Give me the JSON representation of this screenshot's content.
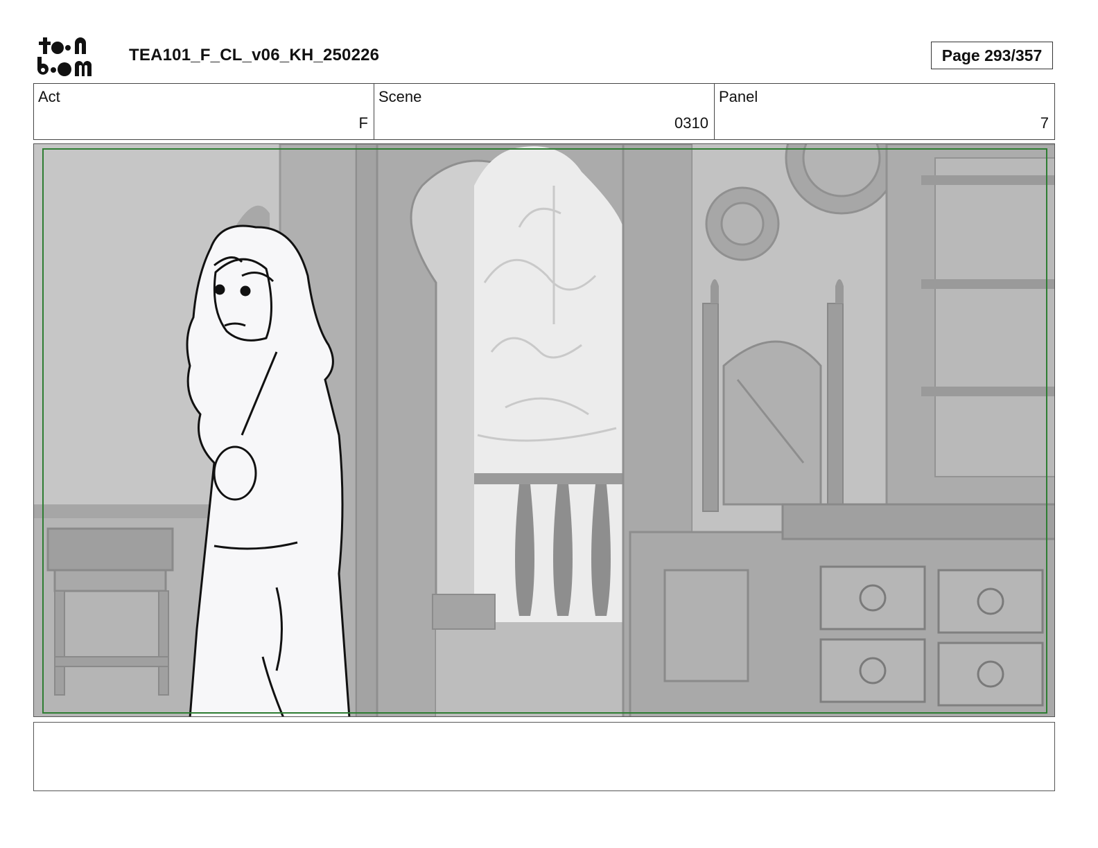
{
  "header": {
    "logo_text": "toon boom",
    "document_title": "TEA101_F_CL_v06_KH_250226",
    "page_indicator": "Page 293/357"
  },
  "info": {
    "act_label": "Act",
    "act_value": "F",
    "scene_label": "Scene",
    "scene_value": "0310",
    "panel_label": "Panel",
    "panel_value": "7"
  },
  "panel": {
    "safe_area_color": "#2e7d32"
  },
  "caption": {
    "text": ""
  }
}
